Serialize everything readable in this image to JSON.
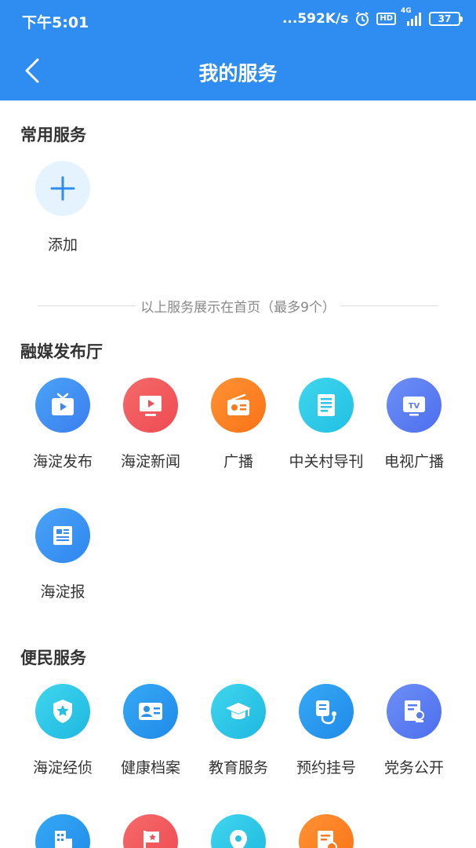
{
  "status_bar": {
    "time": "下午5:01",
    "network_speed": "...592K/s",
    "hd_label": "HD",
    "signal_label": "4G",
    "battery": "37"
  },
  "header": {
    "title": "我的服务"
  },
  "common": {
    "title": "常用服务",
    "add_label": "添加",
    "note": "以上服务展示在首页（最多9个）"
  },
  "media": {
    "title": "融媒发布厅",
    "items": [
      {
        "label": "海淀发布",
        "icon": "tv-icon"
      },
      {
        "label": "海淀新闻",
        "icon": "video-icon"
      },
      {
        "label": "广播",
        "icon": "radio-icon"
      },
      {
        "label": "中关村导刊",
        "icon": "magazine-icon"
      },
      {
        "label": "电视广播",
        "icon": "tv-icon"
      },
      {
        "label": "海淀报",
        "icon": "newspaper-icon"
      }
    ]
  },
  "civic": {
    "title": "便民服务",
    "items": [
      {
        "label": "海淀经侦",
        "icon": "shield-star-icon"
      },
      {
        "label": "健康档案",
        "icon": "id-card-icon"
      },
      {
        "label": "教育服务",
        "icon": "graduation-cap-icon"
      },
      {
        "label": "预约挂号",
        "icon": "stethoscope-icon"
      },
      {
        "label": "党务公开",
        "icon": "document-stamp-icon"
      }
    ],
    "more_icons": [
      "building-icon",
      "flag-icon",
      "location-pin-icon",
      "document-clock-icon"
    ]
  },
  "colors": {
    "primary": "#2f8cf0",
    "add_bg": "#e4f3fd",
    "orange": "#fb7d1e",
    "red": "#f0545a",
    "cyan": "#2cc8e6",
    "blue": "#3d8ef2",
    "indigo": "#5a7cf0"
  }
}
